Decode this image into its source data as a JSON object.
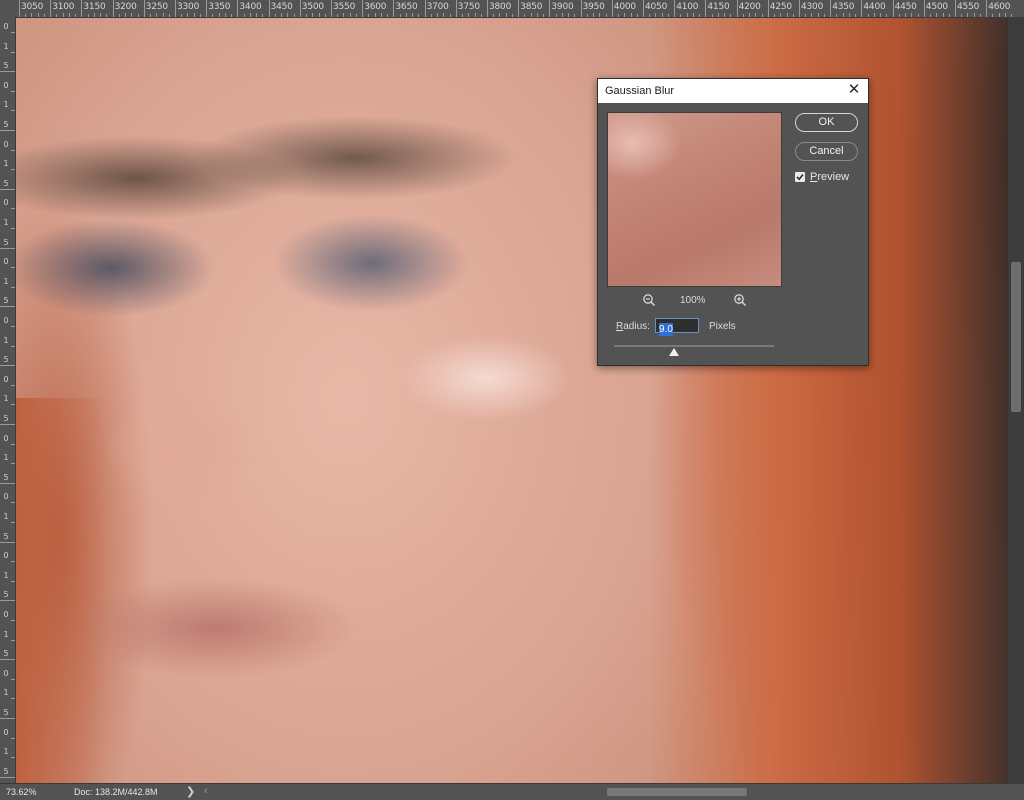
{
  "ruler": {
    "top_labels": [
      "3050",
      "3100",
      "3150",
      "3200",
      "3250",
      "3300",
      "3350",
      "3400",
      "3450",
      "3500",
      "3550",
      "3600",
      "3650",
      "3700",
      "3750",
      "3800",
      "3850",
      "3900",
      "3950",
      "4000",
      "4050",
      "4100",
      "4150",
      "4200",
      "4250",
      "4300",
      "4350",
      "4400",
      "4450",
      "4500",
      "4550",
      "4600"
    ],
    "left_labels": [
      "0",
      "1",
      "5",
      "0",
      "1",
      "5",
      "0",
      "1",
      "5",
      "0",
      "1",
      "5",
      "0",
      "1",
      "5",
      "0",
      "1",
      "5",
      "0",
      "1",
      "5",
      "0",
      "1",
      "5",
      "0",
      "1",
      "5",
      "0",
      "1",
      "5",
      "0",
      "1",
      "5",
      "0",
      "1",
      "5",
      "0",
      "1",
      "5"
    ]
  },
  "dialog": {
    "title": "Gaussian Blur",
    "ok_label": "OK",
    "cancel_label": "Cancel",
    "preview_label_prefix": "P",
    "preview_label_rest": "review",
    "preview_checked": true,
    "zoom_level": "100%",
    "radius_label_prefix": "R",
    "radius_label_rest": "adius:",
    "radius_value": "9.0",
    "radius_unit": "Pixels",
    "radius_slider_value": 9.0
  },
  "status": {
    "zoom": "73.62%",
    "doc": "Doc: 138.2M/442.8M",
    "arrow": "❯"
  },
  "colors": {
    "ui_panel": "#535353",
    "selection_blue": "#2f6fd6"
  }
}
